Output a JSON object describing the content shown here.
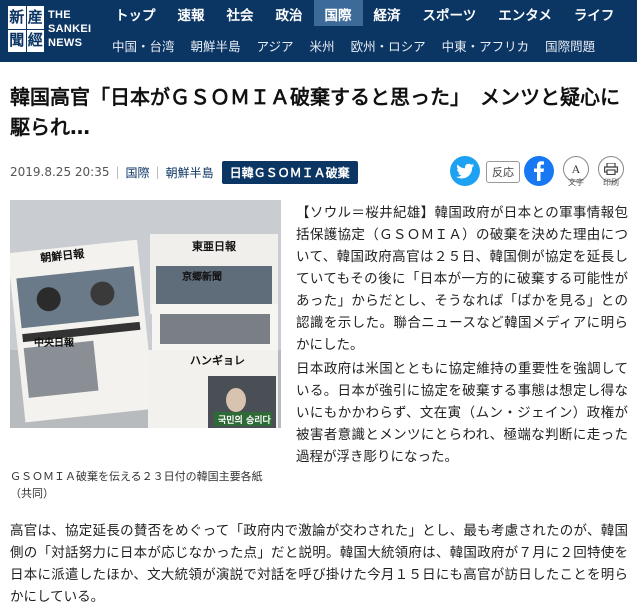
{
  "site": {
    "logo_kanji": [
      "産",
      "經",
      "新",
      "聞"
    ],
    "logo_text_lines": [
      "THE",
      "SANKEI",
      "NEWS"
    ]
  },
  "nav": {
    "main": [
      "トップ",
      "速報",
      "社会",
      "政治",
      "国際",
      "経済",
      "スポーツ",
      "エンタメ",
      "ライフ"
    ],
    "active": "国際",
    "sub": [
      "中国・台湾",
      "朝鮮半島",
      "アジア",
      "米州",
      "欧州・ロシア",
      "中東・アフリカ",
      "国際問題"
    ]
  },
  "article": {
    "title": "韓国高官「日本がＧＳＯＭＩＡ破棄すると思った」　メンツと疑心に駆られ…",
    "date": "2019.8.25 20:35",
    "category_1": "国際",
    "category_2": "朝鮮半島",
    "tag": "日韓ＧＳＯＭＩＡ破棄",
    "share": {
      "twitter_icon": "twitter-icon",
      "react_label": "反応",
      "facebook_icon": "facebook-icon",
      "font_size_label": "文字",
      "print_label": "印刷"
    },
    "photo": {
      "newspapers": [
        "朝鮮日報",
        "東亜日報",
        "京郷新聞",
        "中央日報",
        "ハンギョレ"
      ],
      "sign_text": "국민의 승리다"
    },
    "caption": "ＧＳＯＭＩＡ破棄を伝える２３日付の韓国主要各紙（共同）",
    "paragraphs": [
      "【ソウル＝桜井紀雄】韓国政府が日本との軍事情報包括保護協定（ＧＳＯＭＩＡ）の破棄を決めた理由について、韓国政府高官は２５日、韓国側が協定を延長していてもその後に「日本が一方的に破棄する可能性があった」からだとし、そうなれば「ばかを見る」との認識を示した。聯合ニュースなど韓国メディアに明らかにした。",
      "日本政府は米国とともに協定維持の重要性を強調している。日本が強引に協定を破棄する事態は想定し得ないにもかかわらず、文在寅（ムン・ジェイン）政権が被害者意識とメンツにとらわれ、極端な判断に走った過程が浮き彫りになった。",
      "高官は、協定延長の賛否をめぐって「政府内で激論が交わされた」とし、最も考慮されたのが、韓国側の「対話努力に日本が応じなかった点」だと説明。韓国大統領府は、韓国政府が７月に２回特使を日本に派遣したほか、文大統領が演説で対話を呼び掛けた今月１５日にも高官が訪日したことを明らかにしている。"
    ]
  },
  "colors": {
    "header_bg": "#0b3563",
    "nav_active": "#3c6a99",
    "twitter": "#1da1f2",
    "facebook": "#1877f2"
  }
}
